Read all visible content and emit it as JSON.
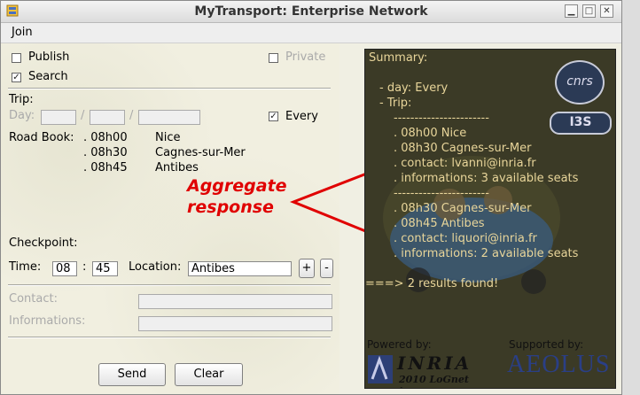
{
  "window": {
    "title": "MyTransport: Enterprise Network",
    "minimize": "▁",
    "maximize": "□",
    "close": "✕"
  },
  "menu": {
    "join": "Join"
  },
  "options": {
    "publish": "Publish",
    "search": "Search",
    "private": "Private"
  },
  "trip": {
    "heading": "Trip:",
    "day_label": "Day:",
    "sep1": "/",
    "sep2": "/",
    "every": "Every"
  },
  "roadbook": {
    "label": "Road Book:",
    "rows": [
      {
        "time": ". 08h00",
        "place": "Nice"
      },
      {
        "time": ". 08h30",
        "place": "Cagnes-sur-Mer"
      },
      {
        "time": ". 08h45",
        "place": "Antibes"
      }
    ]
  },
  "checkpoint": {
    "heading": "Checkpoint:",
    "time_label": "Time:",
    "hour": "08",
    "colon": ":",
    "minute": "45",
    "location_label": "Location:",
    "location_value": "Antibes",
    "plus": "+",
    "minus": "-"
  },
  "contact_label": "Contact:",
  "informations_label": "Informations:",
  "buttons": {
    "send": "Send",
    "clear": "Clear"
  },
  "summary": {
    "lines": [
      "Summary:",
      "",
      "- day: Every",
      "- Trip:",
      "-----------------------",
      ". 08h00        Nice",
      ". 08h30        Cagnes-sur-Mer",
      ". contact: lvanni@inria.fr",
      ". informations: 3 available seats",
      "-----------------------",
      ". 08h30        Cagnes-sur-Mer",
      ". 08h45        Antibes",
      ". contact: liquori@inria.fr",
      ". informations: 2 available seats",
      "",
      "===> 2 results found!"
    ],
    "logo_cnrs": "cnrs",
    "logo_i3s": "I3S",
    "powered_by": "Powered by:",
    "supported_by": "Supported by:",
    "inria": "INRIA",
    "lognet": "2010 LoGnet team",
    "aeolus": "AEOLUS"
  },
  "annotation": {
    "line1": "Aggregate",
    "line2": "response",
    "color": "#e00000"
  }
}
